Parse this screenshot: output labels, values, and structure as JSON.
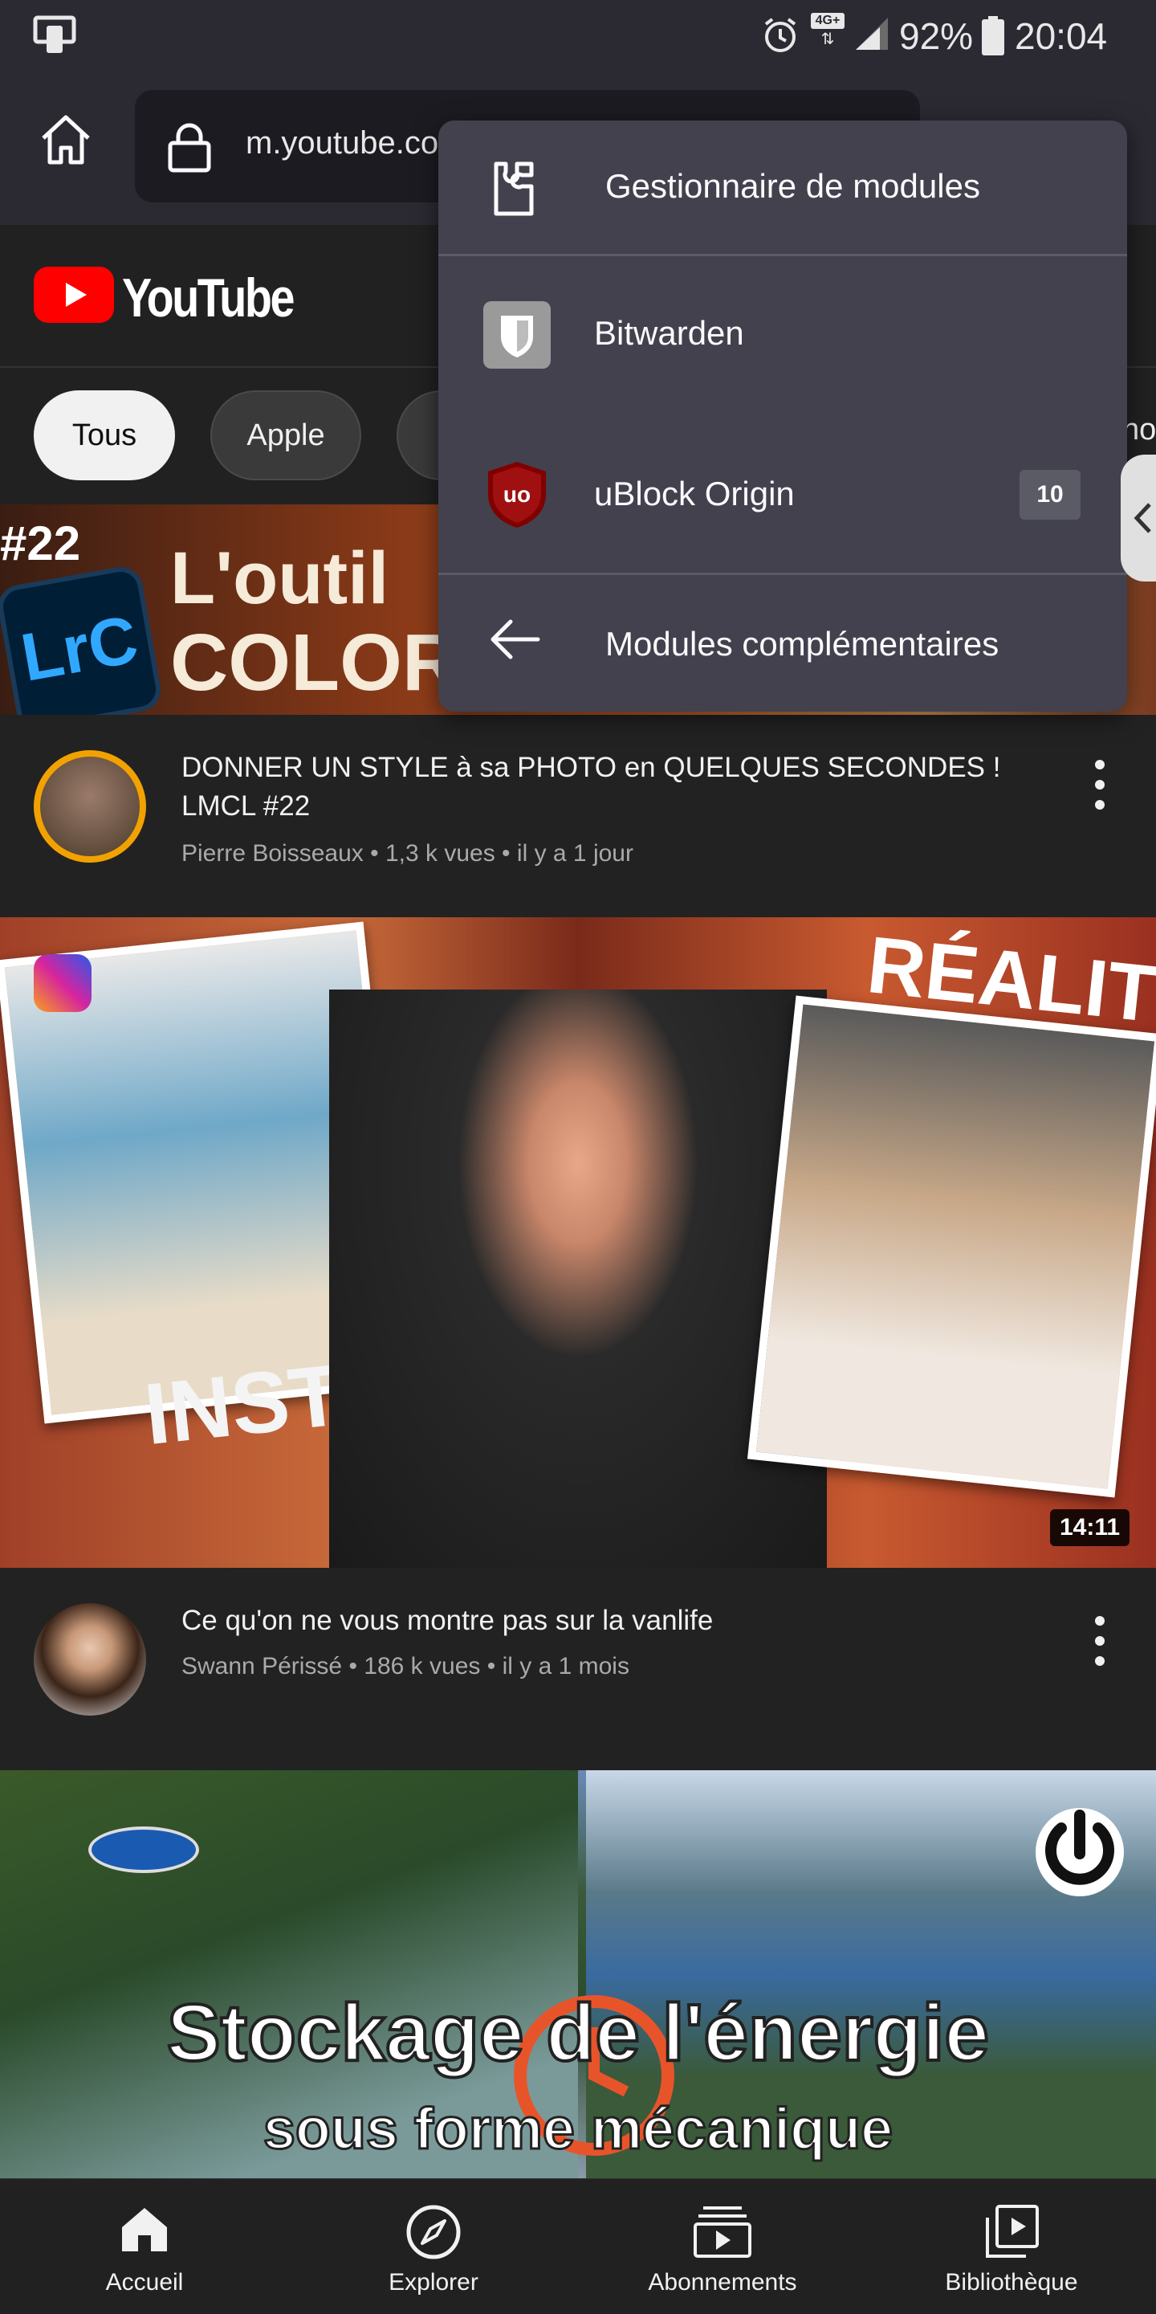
{
  "status_bar": {
    "network": "4G+",
    "battery": "92%",
    "time": "20:04"
  },
  "browser": {
    "url": "m.youtube.com"
  },
  "youtube": {
    "logo_text": "YouTube",
    "chips": [
      "Tous",
      "Apple",
      "",
      "ho"
    ]
  },
  "videos": [
    {
      "thumb_text_1": "#22",
      "thumb_text_2": "L'outil",
      "thumb_text_3": "COLOR",
      "thumb_badge": "LrC",
      "title": "DONNER UN STYLE à sa PHOTO en QUELQUES SECONDES ! LMCL #22",
      "channel": "Pierre Boisseaux",
      "views": "1,3 k vues",
      "age": "il y a 1 jour"
    },
    {
      "thumb_text_1": "RÉALITÉ",
      "thumb_text_2": "INSTA",
      "duration": "14:11",
      "title": "Ce qu'on ne vous montre pas sur la vanlife",
      "channel": "Swann Périssé",
      "views": "186 k vues",
      "age": "il y a 1 mois"
    },
    {
      "thumb_text_1": "Stockage de l'énergie",
      "thumb_text_2": "sous forme mécanique"
    }
  ],
  "popup": {
    "items": [
      {
        "label": "Gestionnaire de modules",
        "icon": "puzzle-icon"
      },
      {
        "label": "Bitwarden",
        "icon": "bitwarden-icon"
      },
      {
        "label": "uBlock Origin",
        "icon": "ublock-icon",
        "badge": "10"
      },
      {
        "label": "Modules complémentaires",
        "icon": "back-arrow-icon"
      }
    ]
  },
  "bottom_nav": [
    {
      "label": "Accueil",
      "icon": "home-icon"
    },
    {
      "label": "Explorer",
      "icon": "compass-icon"
    },
    {
      "label": "Abonnements",
      "icon": "subscriptions-icon"
    },
    {
      "label": "Bibliothèque",
      "icon": "library-icon"
    }
  ],
  "colors": {
    "browser_chrome": "#2b2a33",
    "popup_bg": "#42414d",
    "youtube_red": "#ff0000",
    "page_bg": "#222222"
  }
}
